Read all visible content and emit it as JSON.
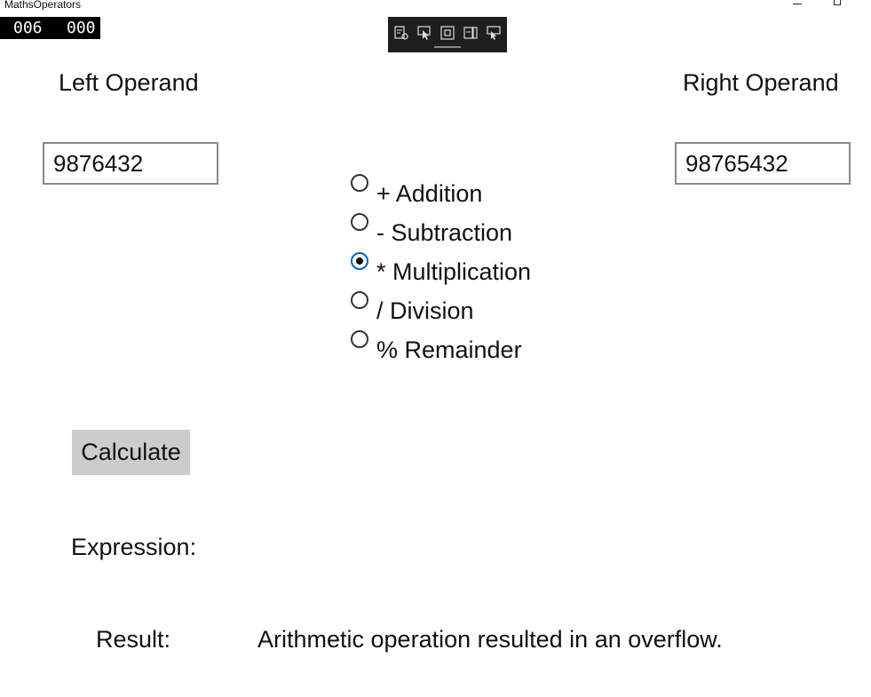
{
  "window": {
    "title": "MathsOperators",
    "minimize_icon": "minimize-icon",
    "maximize_icon": "maximize-icon"
  },
  "frame_counter": {
    "left": "006",
    "right": "000"
  },
  "debug_toolbar": {
    "icons": [
      "live-visual-tree-icon",
      "select-element-icon",
      "display-layout-adorners-icon",
      "track-focus-icon",
      "hot-reload-icon"
    ]
  },
  "operands": {
    "left_label": "Left Operand",
    "left_value": "9876432",
    "right_label": "Right Operand",
    "right_value": "98765432"
  },
  "operators": {
    "selected": "* Multiplication",
    "options": [
      {
        "label": "+ Addition",
        "checked": false
      },
      {
        "label": "- Subtraction",
        "checked": false
      },
      {
        "label": "* Multiplication",
        "checked": true
      },
      {
        "label": "/ Division",
        "checked": false
      },
      {
        "label": "% Remainder",
        "checked": false
      }
    ]
  },
  "actions": {
    "calculate_label": "Calculate"
  },
  "output": {
    "expression_label": "Expression:",
    "expression_value": "",
    "result_label": "Result:",
    "result_value": "Arithmetic operation resulted in an overflow."
  },
  "colors": {
    "radio_accent": "#0067c0",
    "button_bg": "#cccccc",
    "input_border": "#8a8a8a",
    "toolbar_bg": "#1e1e1e"
  }
}
